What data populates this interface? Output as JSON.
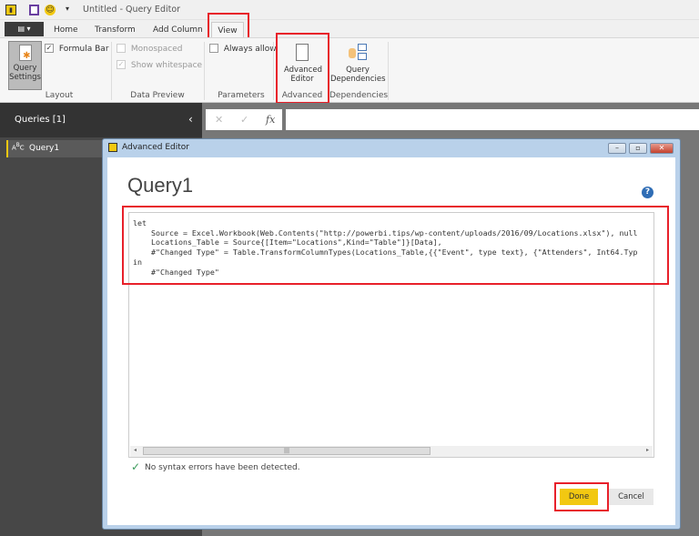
{
  "window": {
    "title": "Untitled - Query Editor"
  },
  "tabs": [
    {
      "label": "Home"
    },
    {
      "label": "Transform"
    },
    {
      "label": "Add Column"
    },
    {
      "label": "View",
      "active": true
    }
  ],
  "ribbon": {
    "query_settings": "Query Settings",
    "formula_bar": {
      "label": "Formula Bar",
      "checked": true
    },
    "monospaced": {
      "label": "Monospaced",
      "checked": false,
      "enabled": false
    },
    "show_whitespace": {
      "label": "Show whitespace",
      "checked": true,
      "enabled": false
    },
    "always_allow": {
      "label": "Always allow",
      "checked": false
    },
    "advanced_editor": "Advanced Editor",
    "query_dependencies": "Query Dependencies",
    "groups": [
      "Layout",
      "Data Preview",
      "Parameters",
      "Advanced",
      "Dependencies"
    ]
  },
  "queries": {
    "header": "Queries [1]",
    "items": [
      {
        "label": "Query1",
        "selected": true
      }
    ]
  },
  "formula_bar": {
    "value": ""
  },
  "dialog": {
    "title": "Advanced Editor",
    "heading": "Query1",
    "code": "let\n    Source = Excel.Workbook(Web.Contents(\"http://powerbi.tips/wp-content/uploads/2016/09/Locations.xlsx\"), null\n    Locations_Table = Source{[Item=\"Locations\",Kind=\"Table\"]}[Data],\n    #\"Changed Type\" = Table.TransformColumnTypes(Locations_Table,{{\"Event\", type text}, {\"Attenders\", Int64.Typ\nin\n    #\"Changed Type\"",
    "status": "No syntax errors have been detected.",
    "done": "Done",
    "cancel": "Cancel"
  },
  "colors": {
    "accent": "#f2c811",
    "highlight": "#e8202a",
    "status_ok": "#3a9a5a"
  }
}
